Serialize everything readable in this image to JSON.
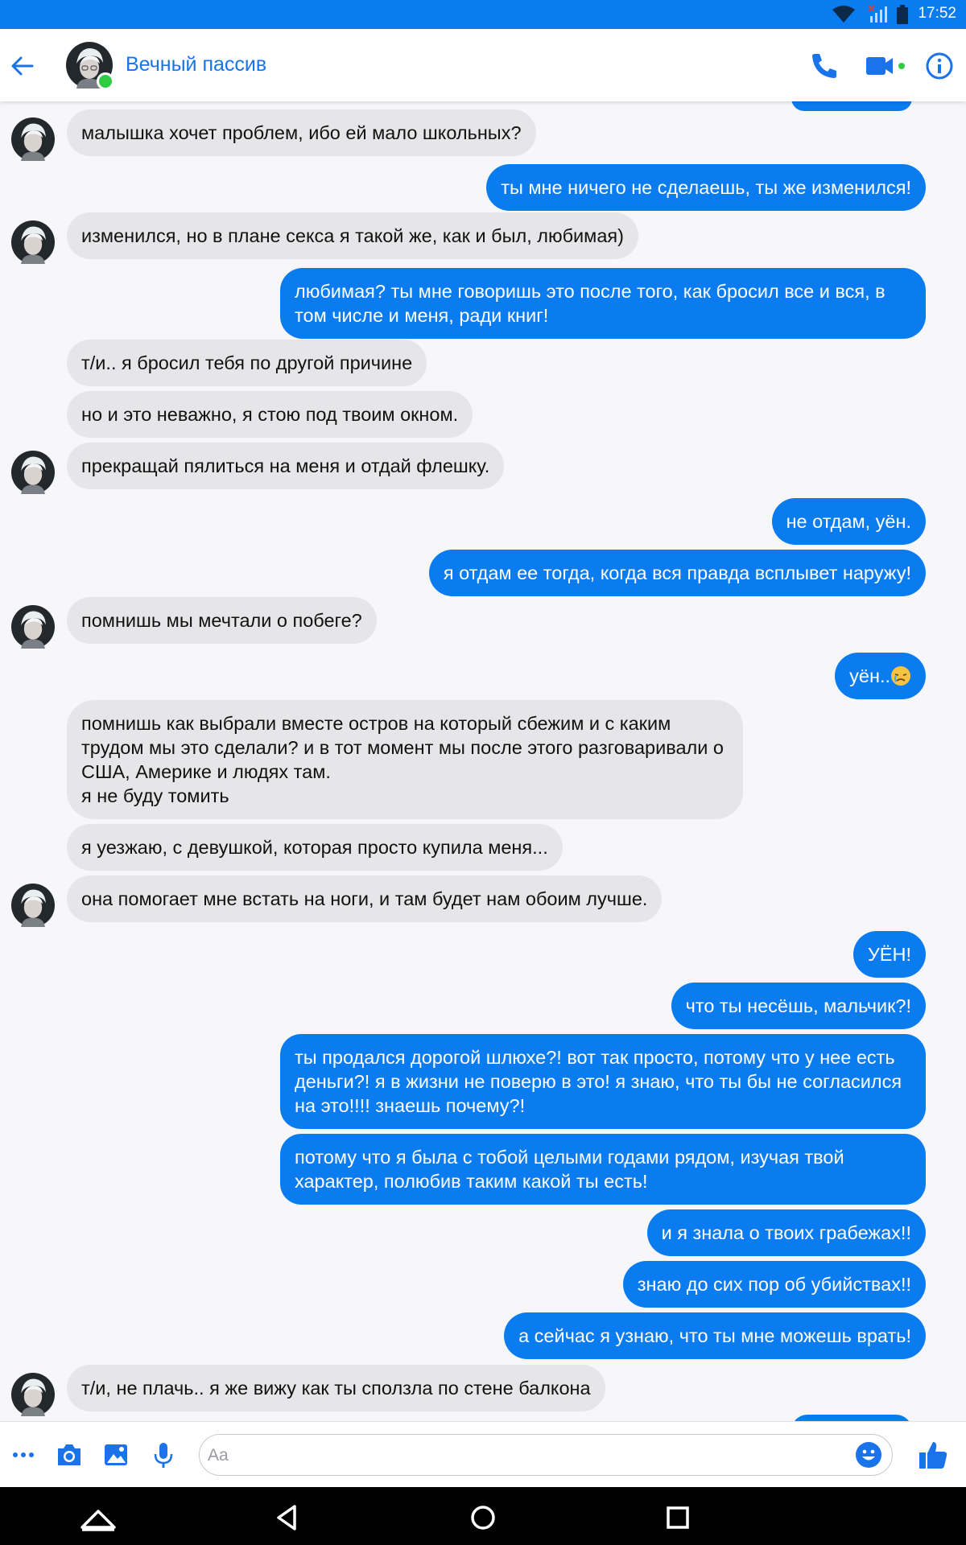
{
  "status_bar": {
    "time": "17:52",
    "icons": [
      "wifi-icon",
      "no-signal-icon",
      "battery-icon"
    ]
  },
  "header": {
    "contact_name": "Вечный пассив",
    "icons": [
      "back-arrow-icon",
      "phone-icon",
      "video-camera-icon",
      "info-icon"
    ]
  },
  "messages": [
    {
      "from": "contact",
      "text": "малышка хочет проблем, ибо ей мало школьных?"
    },
    {
      "from": "me",
      "text": "ты мне ничего не сделаешь, ты же изменился!"
    },
    {
      "from": "contact",
      "text": "изменился, но в плане секса я такой же, как и был, любимая)"
    },
    {
      "from": "me",
      "text": "любимая? ты мне говоришь это после того, как бросил все и вся, в том числе и меня, ради книг!"
    },
    {
      "from": "contact",
      "text": "т/и.. я бросил тебя по другой причине"
    },
    {
      "from": "contact",
      "text": "но и это неважно, я стою под твоим окном."
    },
    {
      "from": "contact",
      "text": "прекращай пялиться на меня и отдай флешку."
    },
    {
      "from": "me",
      "text": "не отдам, уён."
    },
    {
      "from": "me",
      "text": "я отдам ее тогда, когда вся правда всплывет наружу!"
    },
    {
      "from": "contact",
      "text": "помнишь мы мечтали о побеге?"
    },
    {
      "from": "me",
      "text": "уён..",
      "emoji": "crying-face-icon"
    },
    {
      "from": "contact",
      "text": "помнишь как выбрали вместе остров на который сбежим и с каким трудом мы это сделали? и в тот момент мы после этого разговаривали о США, Америке и людях там.\nя не буду томить"
    },
    {
      "from": "contact",
      "text": "я уезжаю, с девушкой, которая просто купила меня..."
    },
    {
      "from": "contact",
      "text": "она помогает мне встать на ноги, и там будет нам обоим лучше."
    },
    {
      "from": "me",
      "text": "УЁН!"
    },
    {
      "from": "me",
      "text": "что ты несёшь, мальчик?!"
    },
    {
      "from": "me",
      "text": "ты продался дорогой шлюхе?! вот так просто, потому что у нее есть деньги?! я в жизни не поверю в это! я знаю, что ты бы не согласился на это!!!! знаешь почему?!"
    },
    {
      "from": "me",
      "text": "потому что я была с тобой целыми годами рядом, изучая твой характер, полюбив таким какой ты есть!"
    },
    {
      "from": "me",
      "text": "и я знала о твоих грабежах!!"
    },
    {
      "from": "me",
      "text": "знаю до сих пор об убийствах!!"
    },
    {
      "from": "me",
      "text": "а сейчас я узнаю, что ты мне можешь врать!"
    },
    {
      "from": "contact",
      "text": "т/и, не плачь.. я же вижу как ты сползла по стене балкона"
    }
  ],
  "composer": {
    "placeholder": "Aa",
    "icons": [
      "more-icon",
      "camera-icon",
      "gallery-icon",
      "microphone-icon",
      "emoji-icon",
      "thumbs-up-icon"
    ]
  },
  "nav_bar": {
    "icons": [
      "home-up-icon",
      "back-triangle-icon",
      "home-circle-icon",
      "recents-square-icon"
    ]
  },
  "colors": {
    "accent": "#0a7cf0",
    "incoming_bubble": "#e6e6e9",
    "background": "#f7f7f9"
  }
}
